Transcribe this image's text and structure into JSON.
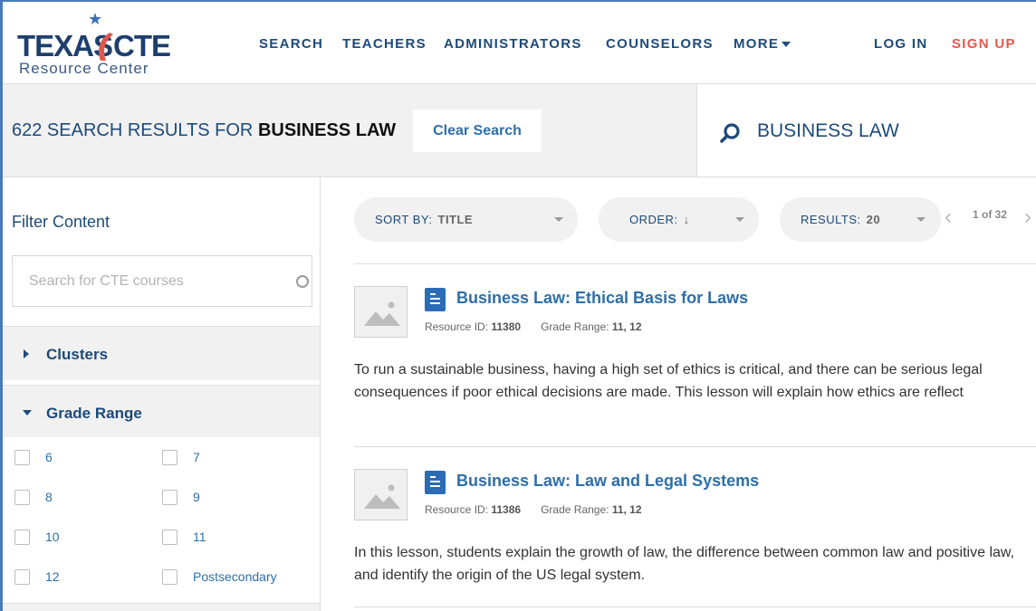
{
  "colors": {
    "brand_blue": "#1d4a79",
    "link_blue": "#2e6fa8",
    "accent_red": "#e2574c",
    "panel_gray": "#f1f1f1"
  },
  "logo": {
    "word_left": "TEXAS",
    "word_right": "CTE",
    "subtitle": "Resource Center"
  },
  "nav": {
    "search": "SEARCH",
    "teachers": "TEACHERS",
    "administrators": "ADMINISTRATORS",
    "counselors": "COUNSELORS",
    "more": "MORE",
    "login": "LOG IN",
    "signup": "SIGN UP"
  },
  "results_bar": {
    "count_prefix": "622 SEARCH RESULTS FOR ",
    "query": "BUSINESS LAW",
    "clear_label": "Clear Search"
  },
  "search_box": {
    "value": "BUSINESS LAW",
    "icon": "search-icon"
  },
  "sidebar": {
    "title": "Filter Content",
    "course_search_placeholder": "Search for CTE courses",
    "clusters_label": "Clusters",
    "grade_label": "Grade Range",
    "grades": [
      "6",
      "7",
      "8",
      "9",
      "10",
      "11",
      "12",
      "Postsecondary"
    ]
  },
  "toolbar": {
    "sort_label": "SORT BY:",
    "sort_value": "TITLE",
    "order_label": "ORDER:",
    "order_value": "↓",
    "results_label": "RESULTS:",
    "results_value": "20",
    "pager": "1 of 32"
  },
  "results": [
    {
      "title": "Business Law: Ethical Basis for Laws",
      "id_label": "Resource ID:",
      "id": "11380",
      "grade_label": "Grade Range:",
      "grades": "11, 12",
      "description": "To run a sustainable business, having a high set of ethics is critical, and there can be serious legal consequences if poor ethical decisions are made.  This lesson will explain how ethics are reflect"
    },
    {
      "title": "Business Law: Law and Legal Systems",
      "id_label": "Resource ID:",
      "id": "11386",
      "grade_label": "Grade Range:",
      "grades": "11, 12",
      "description": "In this lesson, students explain the growth of law, the difference between common law and positive law, and identify the origin of the US legal system."
    }
  ]
}
